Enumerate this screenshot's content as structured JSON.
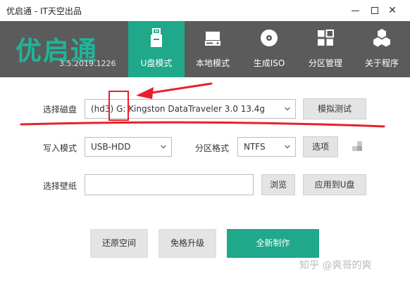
{
  "window": {
    "title": "优启通 - IT天空出品",
    "minimize_icon": "minimize-icon",
    "maximize_icon": "maximize-icon",
    "close_icon": "close-icon",
    "close_glyph": "✕"
  },
  "header": {
    "logo": "优启通",
    "version": "3.5.2019.1226",
    "tabs": [
      {
        "label": "U盘模式",
        "icon": "usb-drive-icon",
        "active": true
      },
      {
        "label": "本地模式",
        "icon": "hard-disk-icon",
        "active": false
      },
      {
        "label": "生成ISO",
        "icon": "disc-icon",
        "active": false
      },
      {
        "label": "分区管理",
        "icon": "partition-grid-icon",
        "active": false
      },
      {
        "label": "关于程序",
        "icon": "cubes-icon",
        "active": false
      }
    ]
  },
  "form": {
    "disk_label": "选择磁盘",
    "disk_value": "(hd3) G: Kingston DataTraveler 3.0 13.4g",
    "simulate_button": "模拟测试",
    "write_mode_label": "写入模式",
    "write_mode_value": "USB-HDD",
    "partition_format_label": "分区格式",
    "partition_format_value": "NTFS",
    "options_button": "选项",
    "wallpaper_label": "选择壁纸",
    "wallpaper_value": "",
    "browse_button": "浏览",
    "apply_button": "应用到U盘"
  },
  "actions": {
    "restore_button": "还原空间",
    "upgrade_button": "免格升级",
    "create_button": "全新制作"
  },
  "watermark": "知乎 @爽哥的爽",
  "colors": {
    "accent": "#1fa889",
    "header_bg": "#5b5b5b",
    "annotation": "#e8202a"
  }
}
